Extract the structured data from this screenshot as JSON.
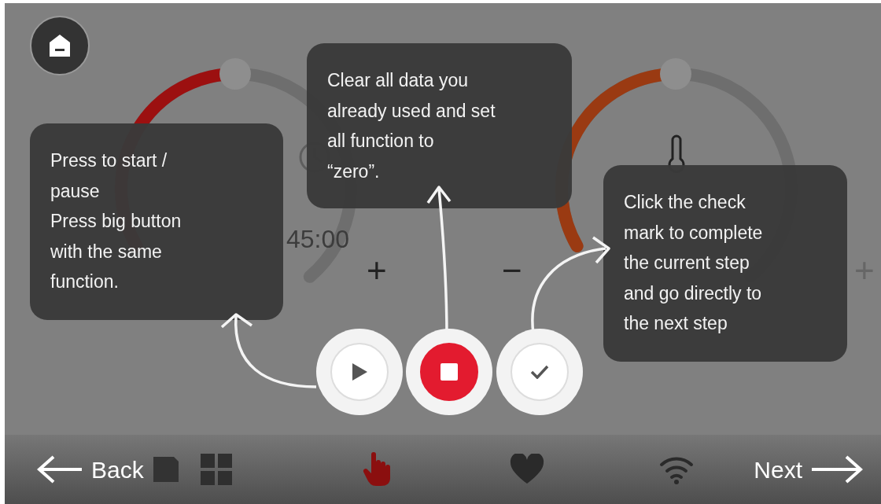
{
  "dials": [
    {
      "kind": "timer",
      "level": 0.46,
      "value": "45:00"
    },
    {
      "kind": "temperature",
      "level": 0.46
    }
  ],
  "adjusters": [
    {
      "symbol": "+"
    },
    {
      "symbol": "−"
    },
    {
      "symbol": "+"
    }
  ],
  "tooltips": [
    {
      "text": "Press to start /\npause\nPress big button\nwith the same\nfunction."
    },
    {
      "text": "Clear all data you\nalready used and set\nall function to\n“zero”."
    },
    {
      "text": "Click the check\nmark  to complete\nthe current step\nand go directly to\nthe next step"
    }
  ],
  "action_buttons": [
    {
      "kind": "play"
    },
    {
      "kind": "stop"
    },
    {
      "kind": "check"
    }
  ],
  "bottom_bar": {
    "back": {
      "label": "Back"
    },
    "next": {
      "label": "Next"
    },
    "tabs": [
      {
        "kind": "grid",
        "selected": false
      },
      {
        "kind": "hand",
        "selected": true
      },
      {
        "kind": "heart",
        "selected": false
      },
      {
        "kind": "wifi",
        "selected": false
      }
    ]
  }
}
